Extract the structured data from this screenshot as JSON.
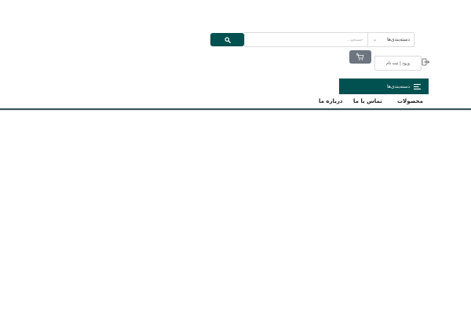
{
  "search": {
    "category_label": "دسته‌بندی‌ها",
    "placeholder": "جستجو...",
    "value": ""
  },
  "cart": {
    "count": "0"
  },
  "account": {
    "login_label": "ورود | ثبت نام"
  },
  "categories_menu": {
    "label": "دسته‌بندی‌ها"
  },
  "nav": {
    "products": "محصولات",
    "contact": "تماس با ما",
    "about": "درباره ما"
  },
  "colors": {
    "primary": "#00514f",
    "cart_button": "#6d7580",
    "divider": "#35545a"
  },
  "icons": {
    "search": "search-icon",
    "cart": "cart-icon",
    "login": "login-icon",
    "menu": "hamburger-icon",
    "dropdown": "chevron-down-icon"
  }
}
